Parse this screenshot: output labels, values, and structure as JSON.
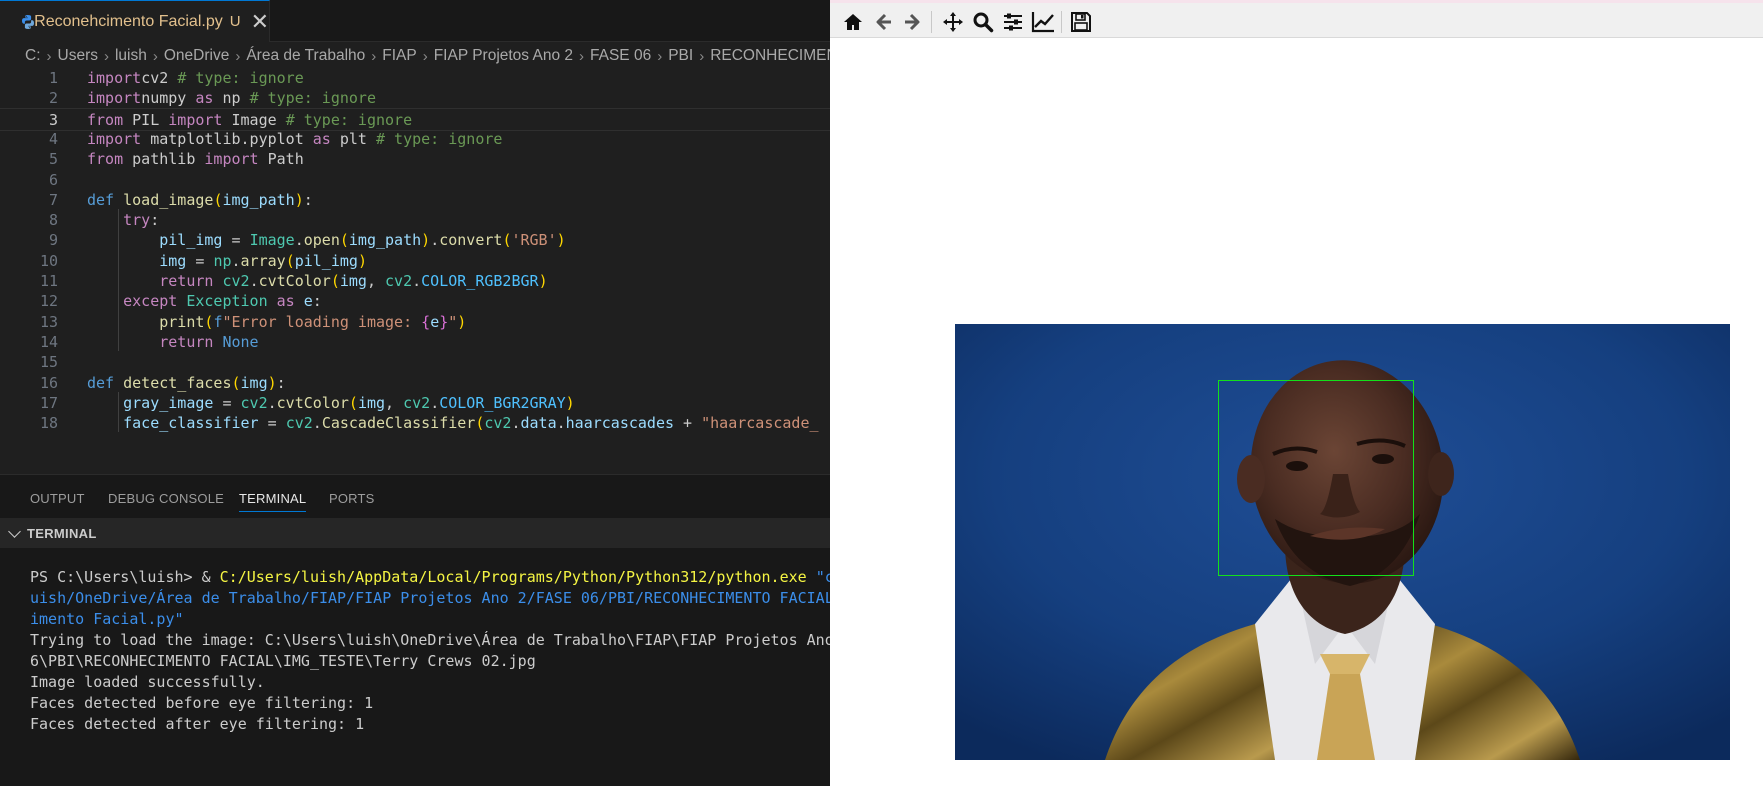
{
  "editor_tab": {
    "filename": "Reconehcimento Facial.py",
    "status": "U",
    "close": "✕"
  },
  "breadcrumb": [
    "C:",
    "Users",
    "luish",
    "OneDrive",
    "Área de Trabalho",
    "FIAP",
    "FIAP Projetos Ano 2",
    "FASE 06",
    "PBI",
    "RECONHECIMENTO"
  ],
  "code_lines": [
    {
      "n": "1",
      "tokens": [
        [
          "k-kw",
          "import"
        ],
        [
          "",
          "cv2 "
        ],
        [
          "k-cm",
          "# type: ignore"
        ]
      ]
    },
    {
      "n": "2",
      "tokens": [
        [
          "k-kw",
          "import"
        ],
        [
          "",
          "numpy "
        ],
        [
          "k-kw",
          "as"
        ],
        [
          "",
          " np "
        ],
        [
          "k-cm",
          "# type: ignore"
        ]
      ]
    },
    {
      "n": "3",
      "tokens": [
        [
          "k-kw",
          "from"
        ],
        [
          "",
          " PIL "
        ],
        [
          "k-kw",
          "import"
        ],
        [
          "",
          " Image "
        ],
        [
          "k-cm",
          "# type: ignore"
        ]
      ]
    },
    {
      "n": "4",
      "tokens": [
        [
          "k-kw",
          "import"
        ],
        [
          "",
          " matplotlib.pyplot "
        ],
        [
          "k-kw",
          "as"
        ],
        [
          "",
          " plt "
        ],
        [
          "k-cm",
          "# type: ignore"
        ]
      ]
    },
    {
      "n": "5",
      "tokens": [
        [
          "k-kw",
          "from"
        ],
        [
          "",
          " pathlib "
        ],
        [
          "k-kw",
          "import"
        ],
        [
          "",
          " Path"
        ]
      ]
    },
    {
      "n": "6",
      "tokens": []
    },
    {
      "n": "7",
      "tokens": [
        [
          "k-def",
          "def"
        ],
        [
          "",
          " "
        ],
        [
          "k-fn",
          "load_image"
        ],
        [
          "k-p1",
          "("
        ],
        [
          "k-var",
          "img_path"
        ],
        [
          "k-p1",
          ")"
        ],
        [
          "",
          ":"
        ]
      ]
    },
    {
      "n": "8",
      "tokens": [
        [
          "",
          "    "
        ],
        [
          "k-kw",
          "try"
        ],
        [
          "",
          ":"
        ]
      ]
    },
    {
      "n": "9",
      "tokens": [
        [
          "",
          "        "
        ],
        [
          "k-var",
          "pil_img"
        ],
        [
          "",
          " = "
        ],
        [
          "k-cls",
          "Image"
        ],
        [
          "",
          "."
        ],
        [
          "k-fn",
          "open"
        ],
        [
          "k-p1",
          "("
        ],
        [
          "k-var",
          "img_path"
        ],
        [
          "k-p1",
          ")"
        ],
        [
          "",
          "."
        ],
        [
          "k-fn",
          "convert"
        ],
        [
          "k-p1",
          "("
        ],
        [
          "k-str",
          "'RGB'"
        ],
        [
          "k-p1",
          ")"
        ]
      ]
    },
    {
      "n": "10",
      "tokens": [
        [
          "",
          "        "
        ],
        [
          "k-var",
          "img"
        ],
        [
          "",
          " = "
        ],
        [
          "k-cls",
          "np"
        ],
        [
          "",
          "."
        ],
        [
          "k-fn",
          "array"
        ],
        [
          "k-p1",
          "("
        ],
        [
          "k-var",
          "pil_img"
        ],
        [
          "k-p1",
          ")"
        ]
      ]
    },
    {
      "n": "11",
      "tokens": [
        [
          "",
          "        "
        ],
        [
          "k-kw",
          "return"
        ],
        [
          "",
          " "
        ],
        [
          "k-cls",
          "cv2"
        ],
        [
          "",
          "."
        ],
        [
          "k-fn",
          "cvtColor"
        ],
        [
          "k-p1",
          "("
        ],
        [
          "k-var",
          "img"
        ],
        [
          "",
          ", "
        ],
        [
          "k-cls",
          "cv2"
        ],
        [
          "",
          "."
        ],
        [
          "k-const",
          "COLOR_RGB2BGR"
        ],
        [
          "k-p1",
          ")"
        ]
      ]
    },
    {
      "n": "12",
      "tokens": [
        [
          "",
          "    "
        ],
        [
          "k-kw",
          "except"
        ],
        [
          "",
          " "
        ],
        [
          "k-cls",
          "Exception"
        ],
        [
          "",
          " "
        ],
        [
          "k-kw",
          "as"
        ],
        [
          "",
          " "
        ],
        [
          "k-var",
          "e"
        ],
        [
          "",
          ":"
        ]
      ]
    },
    {
      "n": "13",
      "tokens": [
        [
          "",
          "        "
        ],
        [
          "k-fn",
          "print"
        ],
        [
          "k-p1",
          "("
        ],
        [
          "k-def",
          "f"
        ],
        [
          "k-str",
          "\"Error loading image: "
        ],
        [
          "k-p2",
          "{"
        ],
        [
          "k-var",
          "e"
        ],
        [
          "k-p2",
          "}"
        ],
        [
          "k-str",
          "\""
        ],
        [
          "k-p1",
          ")"
        ]
      ]
    },
    {
      "n": "14",
      "tokens": [
        [
          "",
          "        "
        ],
        [
          "k-kw",
          "return"
        ],
        [
          "",
          " "
        ],
        [
          "k-def",
          "None"
        ]
      ]
    },
    {
      "n": "15",
      "tokens": []
    },
    {
      "n": "16",
      "tokens": [
        [
          "k-def",
          "def"
        ],
        [
          "",
          " "
        ],
        [
          "k-fn",
          "detect_faces"
        ],
        [
          "k-p1",
          "("
        ],
        [
          "k-var",
          "img"
        ],
        [
          "k-p1",
          ")"
        ],
        [
          "",
          ":"
        ]
      ]
    },
    {
      "n": "17",
      "tokens": [
        [
          "",
          "    "
        ],
        [
          "k-var",
          "gray_image"
        ],
        [
          "",
          " = "
        ],
        [
          "k-cls",
          "cv2"
        ],
        [
          "",
          "."
        ],
        [
          "k-fn",
          "cvtColor"
        ],
        [
          "k-p1",
          "("
        ],
        [
          "k-var",
          "img"
        ],
        [
          "",
          ", "
        ],
        [
          "k-cls",
          "cv2"
        ],
        [
          "",
          "."
        ],
        [
          "k-const",
          "COLOR_BGR2GRAY"
        ],
        [
          "k-p1",
          ")"
        ]
      ]
    },
    {
      "n": "18",
      "tokens": [
        [
          "",
          "    "
        ],
        [
          "k-var",
          "face_classifier"
        ],
        [
          "",
          " = "
        ],
        [
          "k-cls",
          "cv2"
        ],
        [
          "",
          "."
        ],
        [
          "k-fn",
          "CascadeClassifier"
        ],
        [
          "k-p1",
          "("
        ],
        [
          "k-cls",
          "cv2"
        ],
        [
          "",
          "."
        ],
        [
          "k-var",
          "data"
        ],
        [
          "",
          "."
        ],
        [
          "k-var",
          "haarcascades"
        ],
        [
          "",
          " + "
        ],
        [
          "k-str",
          "\"haarcascade_"
        ]
      ]
    }
  ],
  "active_line": "3",
  "panel": {
    "tabs": [
      "OUTPUT",
      "DEBUG CONSOLE",
      "TERMINAL",
      "PORTS"
    ],
    "active_tab": "TERMINAL",
    "section_title": "TERMINAL"
  },
  "terminal_lines": [
    [
      [
        "",
        "PS C:\\Users\\luish> & "
      ],
      [
        "t-y",
        "C:/Users/luish/AppData/Local/Programs/Python/Python312/python.exe"
      ],
      [
        "",
        " "
      ],
      [
        "t-b",
        "\"c"
      ]
    ],
    [
      [
        "t-b",
        "uish/OneDrive/Área de Trabalho/FIAP/FIAP Projetos Ano 2/FASE 06/PBI/RECONHECIMENTO FACIAL"
      ]
    ],
    [
      [
        "t-b",
        "imento Facial.py\""
      ]
    ],
    [
      [
        "",
        "Trying to load the image: C:\\Users\\luish\\OneDrive\\Área de Trabalho\\FIAP\\FIAP Projetos Ano"
      ]
    ],
    [
      [
        "",
        "6\\PBI\\RECONHECIMENTO FACIAL\\IMG_TESTE\\Terry Crews 02.jpg"
      ]
    ],
    [
      [
        "",
        "Image loaded successfully."
      ]
    ],
    [
      [
        "",
        "Faces detected before eye filtering: 1"
      ]
    ],
    [
      [
        "",
        "Faces detected after eye filtering: 1"
      ]
    ]
  ],
  "mpl_toolbar": [
    "home-icon",
    "back-icon",
    "forward-icon",
    "pan-icon",
    "zoom-icon",
    "configure-subplots-icon",
    "edit-axis-icon",
    "save-icon"
  ],
  "figure": {
    "detected_faces": 1,
    "box_color": "#13e01a",
    "background_color": "#10336a"
  }
}
